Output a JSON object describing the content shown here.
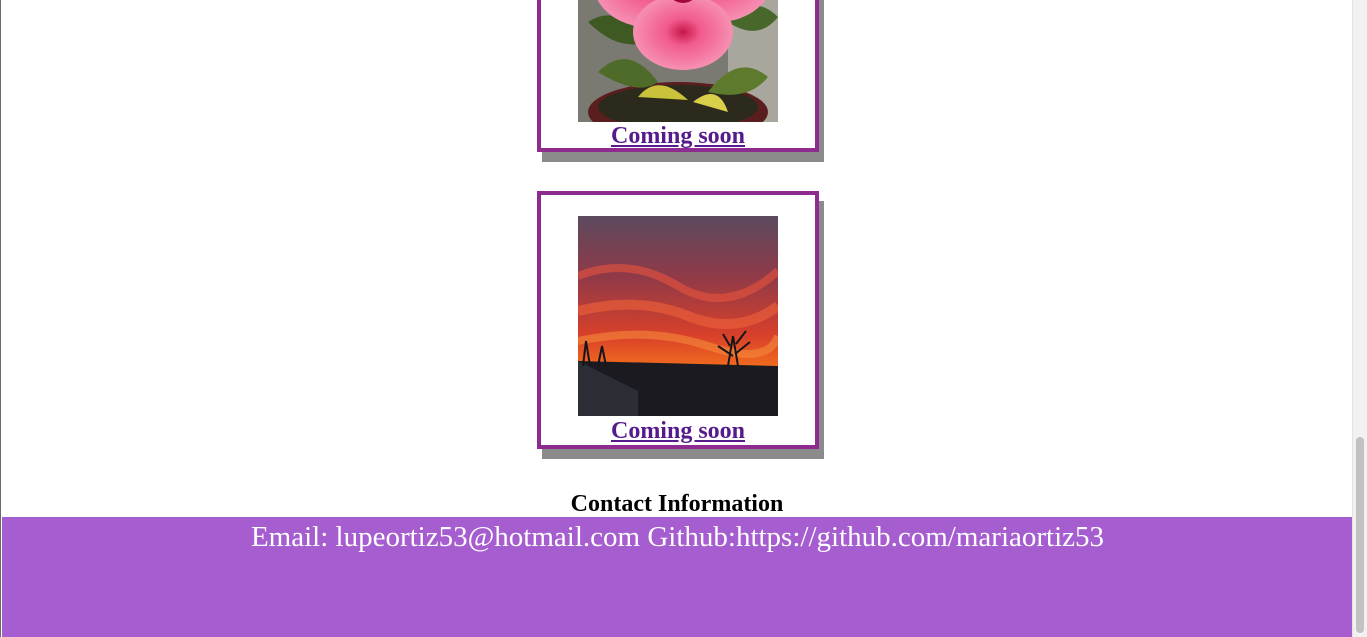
{
  "gallery": {
    "items": [
      {
        "photo_icon": "hibiscus-flower-photo",
        "link_label": "Coming soon"
      },
      {
        "photo_icon": "sunset-sky-photo",
        "link_label": "Coming soon"
      }
    ]
  },
  "contact": {
    "heading": "Contact Information",
    "footer_text": "Email: lupeortiz53@hotmail.com Github:https://github.com/mariaortiz53"
  },
  "colors": {
    "card_border": "#8e2b8e",
    "card_shadow": "#8b8b8b",
    "link": "#551a8b",
    "footer_bg": "#a65dd0",
    "footer_text": "#ffffff"
  }
}
